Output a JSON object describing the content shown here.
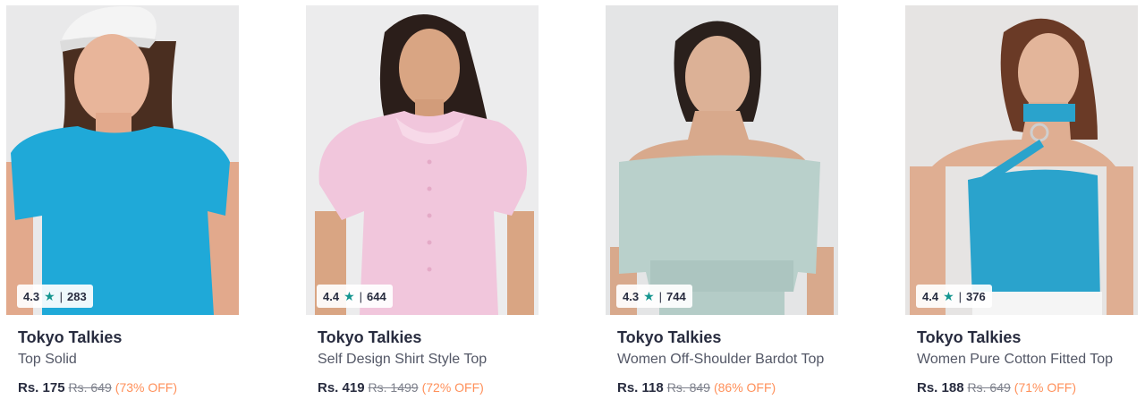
{
  "colors": {
    "star": "#14958f",
    "discount": "#ff905a",
    "brand_text": "#282c3f"
  },
  "products": [
    {
      "rating": "4.3",
      "rating_count": "283",
      "brand": "Tokyo Talkies",
      "title": "Top Solid",
      "price": "Rs. 175",
      "mrp": "Rs. 649",
      "discount": "(73% OFF)",
      "garment_color": "#1fa9d8"
    },
    {
      "rating": "4.4",
      "rating_count": "644",
      "brand": "Tokyo Talkies",
      "title": "Self Design Shirt Style Top",
      "price": "Rs. 419",
      "mrp": "Rs. 1499",
      "discount": "(72% OFF)",
      "garment_color": "#f1c6dc"
    },
    {
      "rating": "4.3",
      "rating_count": "744",
      "brand": "Tokyo Talkies",
      "title": "Women Off-Shoulder Bardot Top",
      "price": "Rs. 118",
      "mrp": "Rs. 849",
      "discount": "(86% OFF)",
      "garment_color": "#b9d0cb"
    },
    {
      "rating": "4.4",
      "rating_count": "376",
      "brand": "Tokyo Talkies",
      "title": "Women Pure Cotton Fitted Top",
      "price": "Rs. 188",
      "mrp": "Rs. 649",
      "discount": "(71% OFF)",
      "garment_color": "#2aa3cc"
    }
  ]
}
